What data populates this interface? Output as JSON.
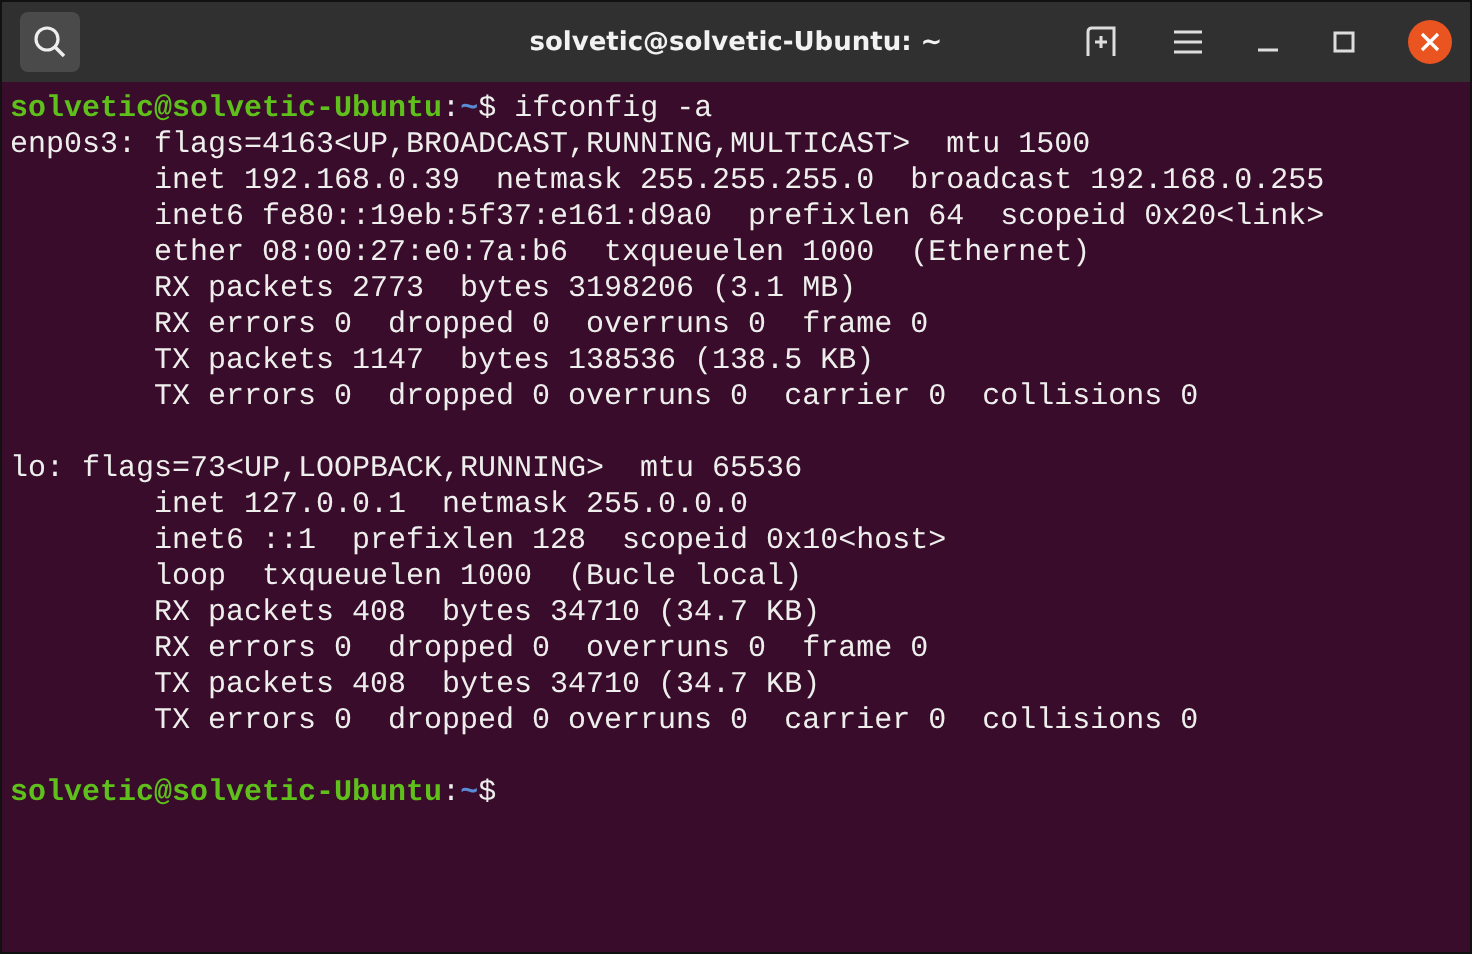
{
  "window": {
    "title": "solvetic@solvetic-Ubuntu: ~"
  },
  "terminal": {
    "lines": [
      {
        "kind": "prompt",
        "user": "solvetic@solvetic-Ubuntu",
        "separator": ":",
        "path": "~",
        "symbol": "$",
        "command": " ifconfig -a"
      },
      {
        "kind": "output",
        "text": "enp0s3: flags=4163<UP,BROADCAST,RUNNING,MULTICAST>  mtu 1500"
      },
      {
        "kind": "output",
        "text": "        inet 192.168.0.39  netmask 255.255.255.0  broadcast 192.168.0.255"
      },
      {
        "kind": "output",
        "text": "        inet6 fe80::19eb:5f37:e161:d9a0  prefixlen 64  scopeid 0x20<link>"
      },
      {
        "kind": "output",
        "text": "        ether 08:00:27:e0:7a:b6  txqueuelen 1000  (Ethernet)"
      },
      {
        "kind": "output",
        "text": "        RX packets 2773  bytes 3198206 (3.1 MB)"
      },
      {
        "kind": "output",
        "text": "        RX errors 0  dropped 0  overruns 0  frame 0"
      },
      {
        "kind": "output",
        "text": "        TX packets 1147  bytes 138536 (138.5 KB)"
      },
      {
        "kind": "output",
        "text": "        TX errors 0  dropped 0 overruns 0  carrier 0  collisions 0"
      },
      {
        "kind": "blank"
      },
      {
        "kind": "output",
        "text": "lo: flags=73<UP,LOOPBACK,RUNNING>  mtu 65536"
      },
      {
        "kind": "output",
        "text": "        inet 127.0.0.1  netmask 255.0.0.0"
      },
      {
        "kind": "output",
        "text": "        inet6 ::1  prefixlen 128  scopeid 0x10<host>"
      },
      {
        "kind": "output",
        "text": "        loop  txqueuelen 1000  (Bucle local)"
      },
      {
        "kind": "output",
        "text": "        RX packets 408  bytes 34710 (34.7 KB)"
      },
      {
        "kind": "output",
        "text": "        RX errors 0  dropped 0  overruns 0  frame 0"
      },
      {
        "kind": "output",
        "text": "        TX packets 408  bytes 34710 (34.7 KB)"
      },
      {
        "kind": "output",
        "text": "        TX errors 0  dropped 0 overruns 0  carrier 0  collisions 0"
      },
      {
        "kind": "blank"
      },
      {
        "kind": "prompt",
        "user": "solvetic@solvetic-Ubuntu",
        "separator": ":",
        "path": "~",
        "symbol": "$"
      }
    ]
  }
}
